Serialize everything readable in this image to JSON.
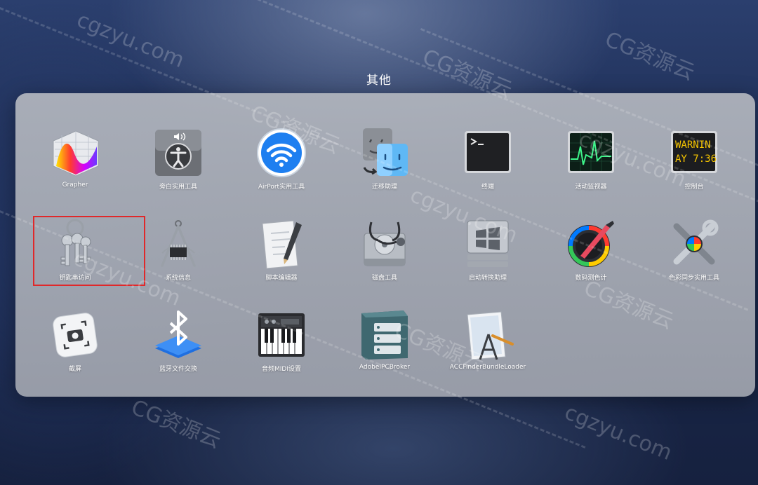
{
  "folder": {
    "title": "其他"
  },
  "apps": [
    {
      "label": "Grapher",
      "icon": "grapher-icon"
    },
    {
      "label": "旁白实用工具",
      "icon": "voiceover-utility-icon"
    },
    {
      "label": "AirPort实用工具",
      "icon": "airport-utility-icon"
    },
    {
      "label": "迁移助理",
      "icon": "migration-assistant-icon"
    },
    {
      "label": "终端",
      "icon": "terminal-icon"
    },
    {
      "label": "活动监视器",
      "icon": "activity-monitor-icon"
    },
    {
      "label": "控制台",
      "icon": "console-icon",
      "screen_text": [
        "WARNIN",
        "AY 7:36"
      ]
    },
    {
      "label": "钥匙串访问",
      "icon": "keychain-access-icon",
      "selected": true
    },
    {
      "label": "系统信息",
      "icon": "system-information-icon"
    },
    {
      "label": "脚本编辑器",
      "icon": "script-editor-icon"
    },
    {
      "label": "磁盘工具",
      "icon": "disk-utility-icon"
    },
    {
      "label": "启动转换助理",
      "icon": "boot-camp-assistant-icon"
    },
    {
      "label": "数码测色计",
      "icon": "digital-color-meter-icon"
    },
    {
      "label": "色彩同步实用工具",
      "icon": "colorsync-utility-icon"
    },
    {
      "label": "截屏",
      "icon": "screenshot-icon"
    },
    {
      "label": "蓝牙文件交换",
      "icon": "bluetooth-file-exchange-icon"
    },
    {
      "label": "音频MIDI设置",
      "icon": "audio-midi-setup-icon"
    },
    {
      "label": "AdobeIPCBroker",
      "icon": "adobe-ipc-broker-icon"
    },
    {
      "label": "ACCFinderBundleLoader",
      "icon": "acc-finder-bundle-loader-icon"
    }
  ],
  "watermarks": [
    "cgzyu.com",
    "CG资源云"
  ],
  "colors": {
    "selection": "#e0282a",
    "folder_bg": "#b2b6be"
  }
}
